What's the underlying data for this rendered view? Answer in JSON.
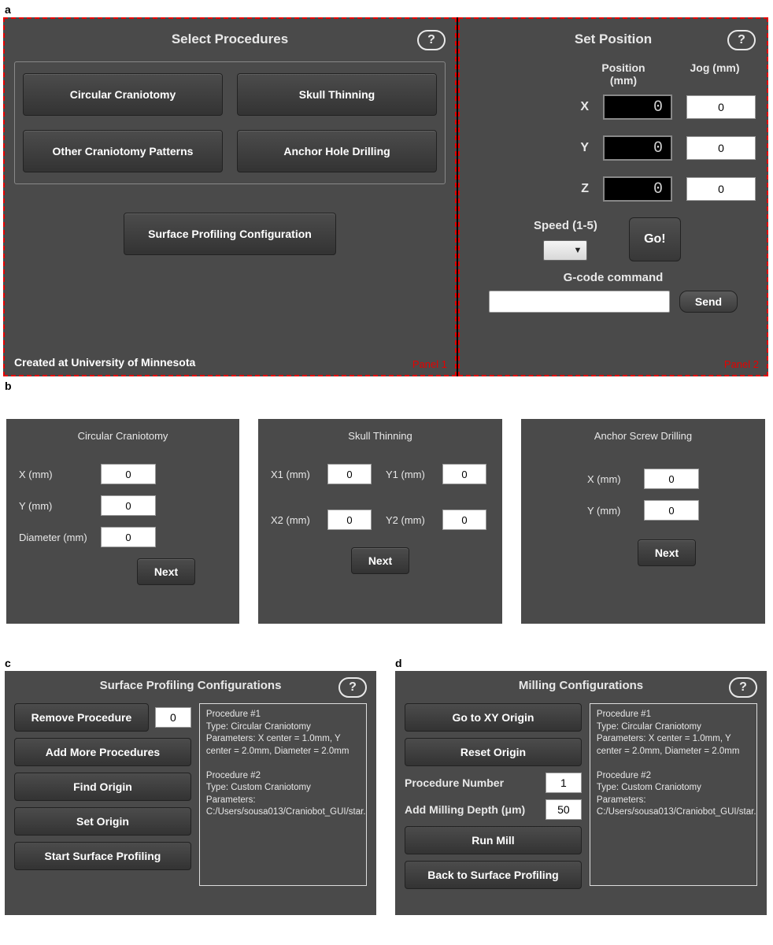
{
  "a": {
    "label": "a",
    "panel1": {
      "title": "Select Procedures",
      "help": "?",
      "buttons": {
        "circular": "Circular Craniotomy",
        "skull": "Skull Thinning",
        "other": "Other Craniotomy Patterns",
        "anchor": "Anchor Hole Drilling"
      },
      "surface_btn": "Surface Profiling Configuration",
      "caption": "Created at University of Minnesota",
      "tag": "Panel 1"
    },
    "panel2": {
      "title": "Set Position",
      "help": "?",
      "col_position": "Position (mm)",
      "col_jog": "Jog (mm)",
      "axes": {
        "x": {
          "label": "X",
          "pos": "0",
          "jog": "0"
        },
        "y": {
          "label": "Y",
          "pos": "0",
          "jog": "0"
        },
        "z": {
          "label": "Z",
          "pos": "0",
          "jog": "0"
        }
      },
      "speed_label": "Speed (1-5)",
      "go_label": "Go!",
      "gcode_label": "G-code command",
      "gcode_value": "",
      "send_label": "Send",
      "tag": "Panel 2"
    }
  },
  "b": {
    "label": "b",
    "circ": {
      "title": "Circular Craniotomy",
      "x_label": "X (mm)",
      "x_val": "0",
      "y_label": "Y (mm)",
      "y_val": "0",
      "d_label": "Diameter (mm)",
      "d_val": "0",
      "next": "Next"
    },
    "skull": {
      "title": "Skull Thinning",
      "x1_label": "X1 (mm)",
      "x1_val": "0",
      "y1_label": "Y1 (mm)",
      "y1_val": "0",
      "x2_label": "X2 (mm)",
      "x2_val": "0",
      "y2_label": "Y2 (mm)",
      "y2_val": "0",
      "next": "Next"
    },
    "anchor": {
      "title": "Anchor Screw Drilling",
      "x_label": "X (mm)",
      "x_val": "0",
      "y_label": "Y (mm)",
      "y_val": "0",
      "next": "Next"
    }
  },
  "c": {
    "label": "c",
    "title": "Surface Profiling Configurations",
    "help": "?",
    "remove_btn": "Remove Procedure",
    "remove_val": "0",
    "add_btn": "Add More Procedures",
    "find_btn": "Find Origin",
    "set_btn": "Set Origin",
    "start_btn": "Start Surface Profiling",
    "proc_text": "Procedure #1\nType: Circular Craniotomy\nParameters: X center = 1.0mm, Y center = 2.0mm, Diameter = 2.0mm\n\nProcedure #2\nType: Custom Craniotomy\nParameters: C:/Users/sousa013/Craniobot_GUI/star.csv"
  },
  "d": {
    "label": "d",
    "title": "Milling Configurations",
    "help": "?",
    "goto_btn": "Go to XY Origin",
    "reset_btn": "Reset Origin",
    "pnum_label": "Procedure Number",
    "pnum_val": "1",
    "depth_label": "Add Milling Depth (μm)",
    "depth_val": "50",
    "run_btn": "Run Mill",
    "back_btn": "Back to Surface Profiling",
    "proc_text": "Procedure #1\nType: Circular Craniotomy\nParameters: X center = 1.0mm, Y center = 2.0mm, Diameter = 2.0mm\n\nProcedure #2\nType: Custom Craniotomy\nParameters: C:/Users/sousa013/Craniobot_GUI/star.csv"
  }
}
